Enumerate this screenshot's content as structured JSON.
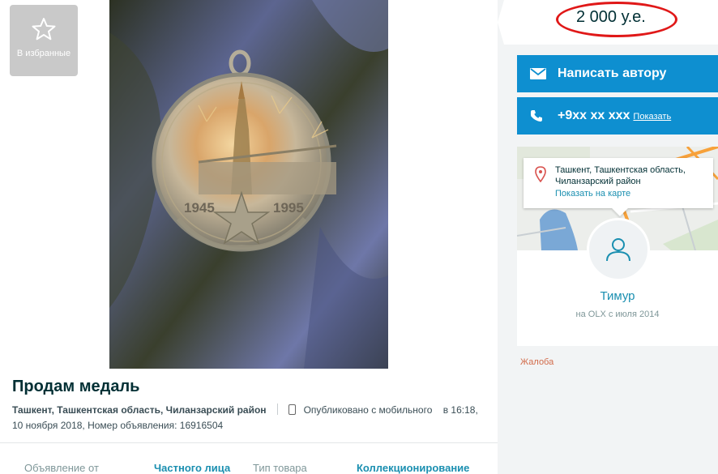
{
  "favorite": {
    "label": "В избранные",
    "icon": "star-outline-icon"
  },
  "listing": {
    "title": "Продам медаль",
    "location": "Ташкент, Ташкентская область, Чиланзарский район",
    "published_from": "Опубликовано с мобильного",
    "published_time": "в 16:18,",
    "date_and_id": "10 ноября 2018, Номер объявления: 16916504",
    "medal_years": [
      "1945",
      "1995"
    ]
  },
  "params": {
    "offered_by_key": "Объявление от",
    "offered_by_value": "Частного лица",
    "type_key": "Тип товара",
    "type_value": "Коллекционирование"
  },
  "price": {
    "value": "2 000 у.е.",
    "highlight_color": "#e01818"
  },
  "actions": {
    "write_label": "Написать автору",
    "phone_label": "+9xx xx xxx",
    "phone_show": "Показать",
    "accent": "#0e8fd0"
  },
  "location_card": {
    "address": "Ташкент, Ташкентская область, Чиланзарский район",
    "map_link": "Показать на карте"
  },
  "seller": {
    "name": "Тимур",
    "since": "на OLX с июля 2014"
  },
  "complaint": "Жалоба"
}
